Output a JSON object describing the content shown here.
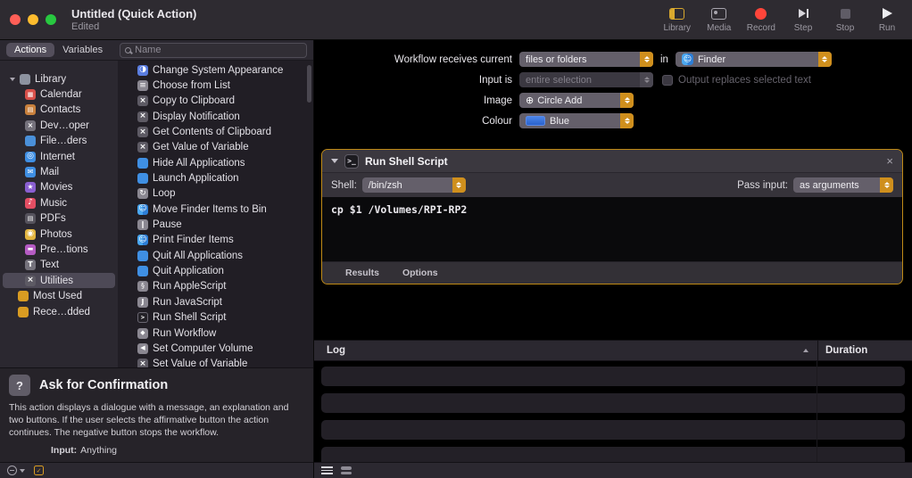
{
  "titlebar": {
    "title": "Untitled (Quick Action)",
    "subtitle": "Edited"
  },
  "toolbar": {
    "items": [
      {
        "label": "Library"
      },
      {
        "label": "Media"
      },
      {
        "label": "Record"
      },
      {
        "label": "Step"
      },
      {
        "label": "Stop"
      },
      {
        "label": "Run"
      }
    ]
  },
  "sidebar": {
    "tabs": [
      {
        "label": "Actions"
      },
      {
        "label": "Variables"
      }
    ],
    "search_placeholder": "Name",
    "categories": [
      {
        "label": "Library",
        "icon": "library"
      },
      {
        "label": "Calendar",
        "icon": "calendar"
      },
      {
        "label": "Contacts",
        "icon": "contacts"
      },
      {
        "label": "Dev…oper",
        "icon": "developer"
      },
      {
        "label": "File…ders",
        "icon": "files"
      },
      {
        "label": "Internet",
        "icon": "internet"
      },
      {
        "label": "Mail",
        "icon": "mail"
      },
      {
        "label": "Movies",
        "icon": "movies"
      },
      {
        "label": "Music",
        "icon": "music"
      },
      {
        "label": "PDFs",
        "icon": "pdfs"
      },
      {
        "label": "Photos",
        "icon": "photos"
      },
      {
        "label": "Pre…tions",
        "icon": "presentations"
      },
      {
        "label": "Text",
        "icon": "text"
      },
      {
        "label": "Utilities",
        "icon": "utilities"
      },
      {
        "label": "Most Used",
        "icon": "folder-amber"
      },
      {
        "label": "Rece…dded",
        "icon": "folder-amber"
      }
    ],
    "actions": [
      {
        "label": "Change System Appearance",
        "icon": "appearance"
      },
      {
        "label": "Choose from List",
        "icon": "choose-list"
      },
      {
        "label": "Copy to Clipboard",
        "icon": "utilities-x"
      },
      {
        "label": "Display Notification",
        "icon": "utilities-x"
      },
      {
        "label": "Get Contents of Clipboard",
        "icon": "utilities-x"
      },
      {
        "label": "Get Value of Variable",
        "icon": "utilities-x"
      },
      {
        "label": "Hide All Applications",
        "icon": "blue-app"
      },
      {
        "label": "Launch Application",
        "icon": "blue-app"
      },
      {
        "label": "Loop",
        "icon": "loop"
      },
      {
        "label": "Move Finder Items to Bin",
        "icon": "finder"
      },
      {
        "label": "Pause",
        "icon": "pause"
      },
      {
        "label": "Print Finder Items",
        "icon": "finder"
      },
      {
        "label": "Quit All Applications",
        "icon": "blue-app"
      },
      {
        "label": "Quit Application",
        "icon": "blue-app"
      },
      {
        "label": "Run AppleScript",
        "icon": "applescript"
      },
      {
        "label": "Run JavaScript",
        "icon": "javascript"
      },
      {
        "label": "Run Shell Script",
        "icon": "shell"
      },
      {
        "label": "Run Workflow",
        "icon": "workflow"
      },
      {
        "label": "Set Computer Volume",
        "icon": "volume"
      },
      {
        "label": "Set Value of Variable",
        "icon": "utilities-x"
      }
    ]
  },
  "workflow": {
    "receives_label": "Workflow receives current",
    "receives_value": "files or folders",
    "in_label": "in",
    "app_value": "Finder",
    "input_is_label": "Input is",
    "input_is_value": "entire selection",
    "output_checkbox_label": "Output replaces selected text",
    "image_label": "Image",
    "image_value": "Circle Add",
    "colour_label": "Colour",
    "colour_value": "Blue"
  },
  "shell_action": {
    "title": "Run Shell Script",
    "shell_label": "Shell:",
    "shell_value": "/bin/zsh",
    "pass_input_label": "Pass input:",
    "pass_input_value": "as arguments",
    "code": "cp $1 /Volumes/RPI-RP2",
    "results_label": "Results",
    "options_label": "Options",
    "close_glyph": "×"
  },
  "log": {
    "title": "Log",
    "duration_label": "Duration"
  },
  "description": {
    "title": "Ask for Confirmation",
    "body": "This action displays a dialogue with a message, an explanation and two buttons. If the user selects the affirmative button the action continues. The negative button stops the workflow.",
    "input_label": "Input:",
    "input_value": "Anything"
  },
  "colors": {
    "accent": "#cf8f1d",
    "record_red": "#ff453a",
    "blue_swatch": "#2f6fde",
    "selection_highlight": "#4d4956",
    "action_block_border": "#bf8a16"
  }
}
